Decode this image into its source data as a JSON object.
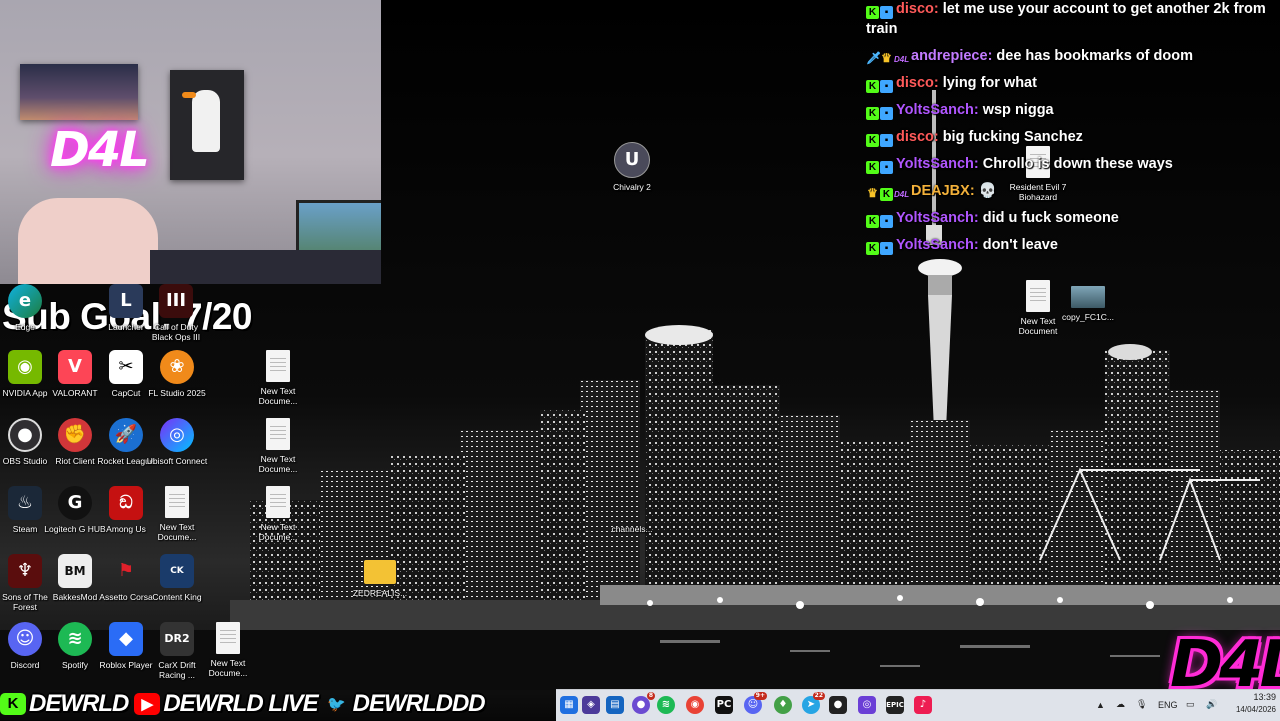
{
  "overlay": {
    "sub_goal": "Sub Goal: 7/20",
    "neon_sign": "D4L",
    "corner_logo": "D4L"
  },
  "chat": [
    {
      "badges": [
        "k",
        "cube"
      ],
      "user": "disco:",
      "color": "#ff5a5a",
      "text": "let me use your account to get another 2k from train"
    },
    {
      "badges": [
        "sword",
        "crown",
        "d4l"
      ],
      "user": "andrepiece:",
      "color": "#c27bff",
      "text": "dee has bookmarks of doom"
    },
    {
      "badges": [
        "k",
        "cube"
      ],
      "user": "disco:",
      "color": "#ff5a5a",
      "text": "lying for what"
    },
    {
      "badges": [
        "k",
        "cube"
      ],
      "user": "YoltsSanch:",
      "color": "#b056ff",
      "text": "wsp nigga"
    },
    {
      "badges": [
        "k",
        "cube"
      ],
      "user": "disco:",
      "color": "#ff5a5a",
      "text": "big fucking Sanchez"
    },
    {
      "badges": [
        "k",
        "cube"
      ],
      "user": "YoltsSanch:",
      "color": "#b056ff",
      "text": "Chrollo is down these ways"
    },
    {
      "badges": [
        "crown",
        "k",
        "d4l"
      ],
      "user": "DEAJBX:",
      "color": "#f3b13a",
      "text": "💀"
    },
    {
      "badges": [
        "k",
        "cube"
      ],
      "user": "YoltsSanch:",
      "color": "#b056ff",
      "text": "did u fuck someone"
    },
    {
      "badges": [
        "k",
        "cube"
      ],
      "user": "YoltsSanch:",
      "color": "#b056ff",
      "text": "don't leave"
    }
  ],
  "desktop_icons": {
    "edge": "Edge",
    "launcher": "Launcher",
    "cod": "Call of Duty Black Ops III",
    "nvidia": "NVIDIA App",
    "valorant": "VALORANT",
    "capcut": "CapCut",
    "fl": "FL Studio 2025",
    "txt1": "New Text Docume...",
    "obs": "OBS Studio",
    "riot": "Riot Client",
    "rocket": "Rocket League",
    "ubisoft": "Ubisoft Connect",
    "txt2": "New Text Docume...",
    "steam": "Steam",
    "logitech": "Logitech G HUB",
    "amongus": "Among Us",
    "txt3": "New Text Docume...",
    "txt4": "New Text Docume...",
    "sons": "Sons of The Forest",
    "bakkes": "BakkesMod",
    "assetto": "Assetto Corsa",
    "content": "Content King",
    "zed": "ZEDREALIS...",
    "discord": "Discord",
    "spotify": "Spotify",
    "roblox": "Roblox Player",
    "carx": "CarX Drift Racing ...",
    "txt5": "New Text Docume...",
    "chivalry": "Chivalry 2",
    "channels": "channels...",
    "resident": "Resident Evil 7 Biohazard",
    "txt6": "New Text Document",
    "copy": "copy_FC1C..."
  },
  "banner": [
    {
      "platform": "kick",
      "logo": "K",
      "handle": "DEWRLD",
      "color": "#53fc18"
    },
    {
      "platform": "youtube",
      "logo": "▶",
      "handle": "DEWRLD LIVE",
      "color": "#ff0000"
    },
    {
      "platform": "twitter",
      "logo": "🐦",
      "handle": "DEWRLDDD",
      "color": "#1da1f2"
    }
  ],
  "taskbar": {
    "tray_lang": "ENG",
    "time": "13:39",
    "date": "14/04/2026",
    "badges": {
      "app2": "8",
      "app8": "9+",
      "app10": "22"
    }
  },
  "colors": {
    "accent": "#ff2bd6",
    "taskbar": "#dfe3ea"
  }
}
